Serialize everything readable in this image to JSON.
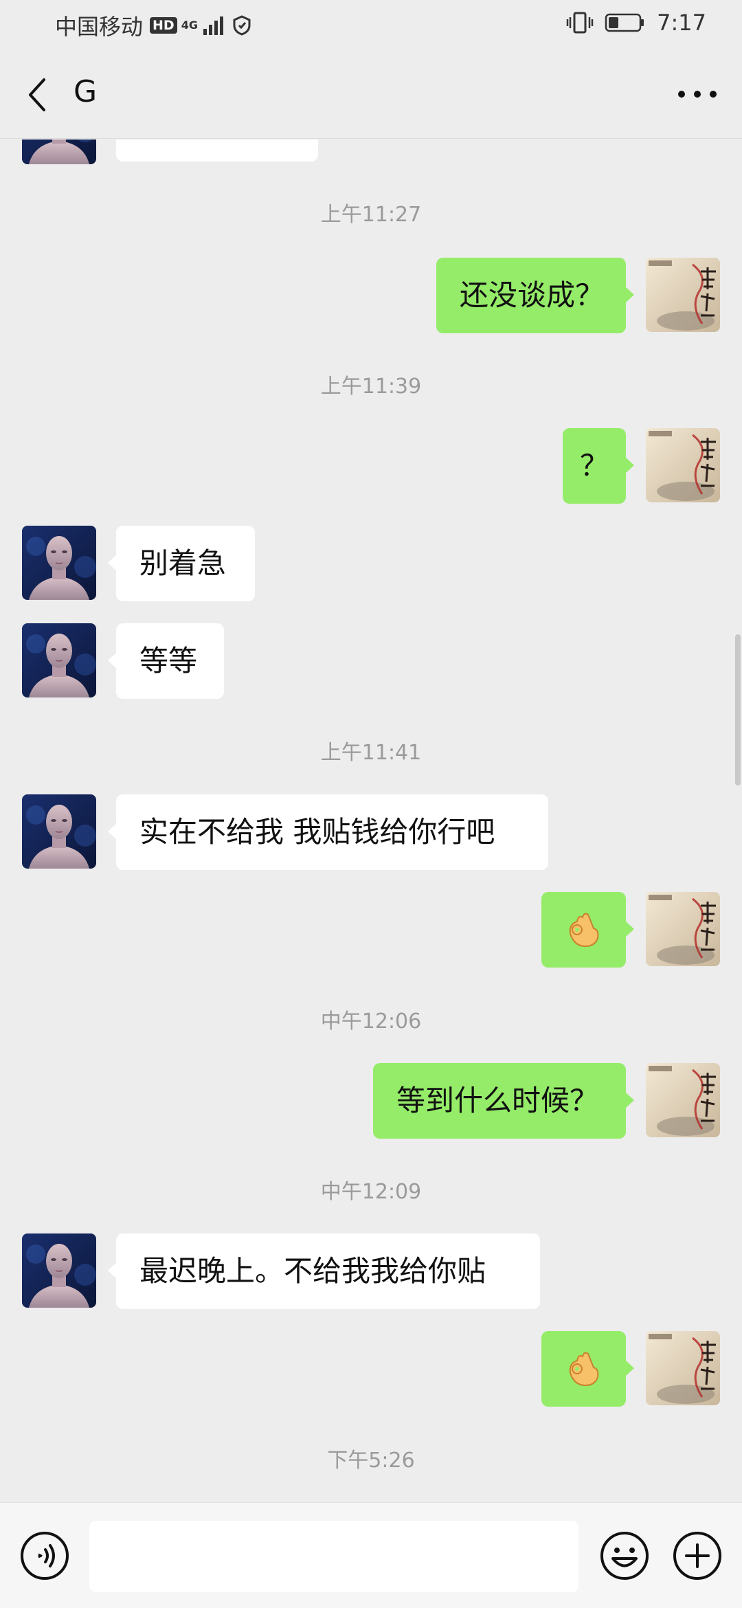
{
  "status_bar": {
    "carrier": "中国移动",
    "hd": "HD",
    "network": "4G",
    "time": "7:17"
  },
  "header": {
    "title": "G",
    "back_icon": "chevron-left-icon",
    "more_icon": "more-dots-icon"
  },
  "messages": {
    "ts1": "上午11:27",
    "m1": "还没谈成？",
    "ts2": "上午11:39",
    "m2": "？",
    "m3": "别着急",
    "m4": "等等",
    "ts3": "上午11:41",
    "m5": "实在不给我 我贴钱给你行吧",
    "m6": "ok-hand-emoji",
    "ts4": "中午12:06",
    "m7": "等到什么时候？",
    "ts5": "中午12:09",
    "m8": "最迟晚上。不给我我给你贴",
    "m9": "ok-hand-emoji",
    "ts6": "下午5:26"
  },
  "input_bar": {
    "voice_icon": "voice-icon",
    "emoji_icon": "emoji-icon",
    "plus_icon": "plus-icon",
    "placeholder": ""
  },
  "colors": {
    "background": "#ededed",
    "outgoing_bubble": "#95ec69",
    "incoming_bubble": "#ffffff",
    "timestamp": "#9a9a9a"
  }
}
